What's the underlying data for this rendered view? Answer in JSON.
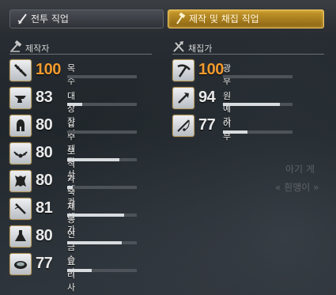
{
  "tabs": {
    "combat_label": "전투 직업",
    "craft_label": "제작 및 채집 직업"
  },
  "crafters": {
    "title": "제작자",
    "jobs": [
      {
        "level": "100",
        "name": "목수",
        "progress": 0.0,
        "max": true
      },
      {
        "level": "83",
        "name": "대장장이",
        "progress": 0.22
      },
      {
        "level": "80",
        "name": "갑주제작사",
        "progress": 0.0
      },
      {
        "level": "80",
        "name": "보석공예가",
        "progress": 0.75
      },
      {
        "level": "80",
        "name": "가죽공예가",
        "progress": 0.08
      },
      {
        "level": "81",
        "name": "재봉사",
        "progress": 0.82
      },
      {
        "level": "80",
        "name": "연금술사",
        "progress": 0.78
      },
      {
        "level": "77",
        "name": "요리사",
        "progress": 0.35
      }
    ]
  },
  "gatherers": {
    "title": "채집가",
    "jobs": [
      {
        "level": "100",
        "name": "광부",
        "progress": 0.0,
        "max": true
      },
      {
        "level": "94",
        "name": "원예가",
        "progress": 0.82
      },
      {
        "level": "77",
        "name": "어부",
        "progress": 0.35
      }
    ]
  },
  "background_text": {
    "line1": "아기 게",
    "line2": "« 흰맹이 »"
  }
}
